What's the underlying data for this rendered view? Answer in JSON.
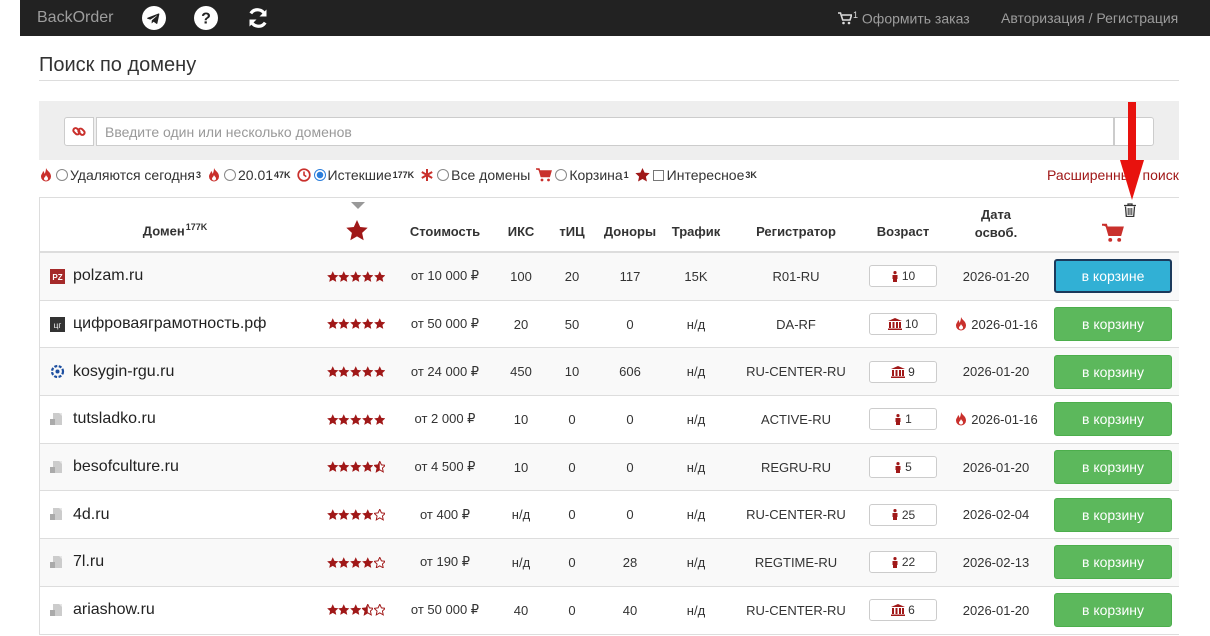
{
  "nav": {
    "brand": "BackOrder",
    "order_label": "Оформить заказ",
    "order_count": "1",
    "auth_label": "Авторизация / Регистрация"
  },
  "page": {
    "title": "Поиск по домену"
  },
  "search": {
    "placeholder": "Введите один или несколько доменов"
  },
  "filters": [
    {
      "label": "Удаляются сегодня",
      "count": "3"
    },
    {
      "label": "20.01",
      "count": "47K"
    },
    {
      "label": "Истекшие",
      "count": "177K",
      "selected": true
    },
    {
      "label": "Все домены",
      "count": ""
    },
    {
      "label": "Корзина",
      "count": "1"
    },
    {
      "label": "Интересное",
      "count": "3K"
    }
  ],
  "advanced_search": "Расширенный поиск",
  "table": {
    "headers": {
      "domain": "Домен",
      "domain_count": "177K",
      "cost": "Стоимость",
      "iks": "ИКС",
      "tic": "тИЦ",
      "donors": "Доноры",
      "traffic": "Трафик",
      "registrar": "Регистратор",
      "age": "Возраст",
      "date_line1": "Дата",
      "date_line2": "освоб."
    },
    "rows": [
      {
        "domain": "polzam.ru",
        "rating": 5,
        "cost": "от 10 000 ₽",
        "iks": "100",
        "tic": "20",
        "donors": "117",
        "traffic": "15K",
        "registrar": "R01-RU",
        "age": "10",
        "date": "2026-01-20",
        "button": "в корзине"
      },
      {
        "domain": "цифроваяграмотность.рф",
        "rating": 5,
        "cost": "от 50 000 ₽",
        "iks": "20",
        "tic": "50",
        "donors": "0",
        "traffic": "н/д",
        "registrar": "DA-RF",
        "age": "10",
        "date": "2026-01-16",
        "button": "в корзину"
      },
      {
        "domain": "kosygin-rgu.ru",
        "rating": 5,
        "cost": "от 24 000 ₽",
        "iks": "450",
        "tic": "10",
        "donors": "606",
        "traffic": "н/д",
        "registrar": "RU-CENTER-RU",
        "age": "9",
        "date": "2026-01-20",
        "button": "в корзину"
      },
      {
        "domain": "tutsladko.ru",
        "rating": 5,
        "cost": "от 2 000 ₽",
        "iks": "10",
        "tic": "0",
        "donors": "0",
        "traffic": "н/д",
        "registrar": "ACTIVE-RU",
        "age": "1",
        "date": "2026-01-16",
        "button": "в корзину"
      },
      {
        "domain": "besofculture.ru",
        "rating": 4.5,
        "cost": "от 4 500 ₽",
        "iks": "10",
        "tic": "0",
        "donors": "0",
        "traffic": "н/д",
        "registrar": "REGRU-RU",
        "age": "5",
        "date": "2026-01-20",
        "button": "в корзину"
      },
      {
        "domain": "4d.ru",
        "rating": 4,
        "cost": "от 400 ₽",
        "iks": "н/д",
        "tic": "0",
        "donors": "0",
        "traffic": "н/д",
        "registrar": "RU-CENTER-RU",
        "age": "25",
        "date": "2026-02-04",
        "button": "в корзину"
      },
      {
        "domain": "7l.ru",
        "rating": 4,
        "cost": "от 190 ₽",
        "iks": "н/д",
        "tic": "0",
        "donors": "28",
        "traffic": "н/д",
        "registrar": "REGTIME-RU",
        "age": "22",
        "date": "2026-02-13",
        "button": "в корзину"
      },
      {
        "domain": "ariashow.ru",
        "rating": 3.5,
        "cost": "от 50 000 ₽",
        "iks": "40",
        "tic": "0",
        "donors": "40",
        "traffic": "н/д",
        "registrar": "RU-CENTER-RU",
        "age": "6",
        "date": "2026-01-20",
        "button": "в корзину"
      }
    ]
  },
  "colors": {
    "accent_red": "#a01818",
    "cart_green": "#5cb85c",
    "in_cart_blue": "#31b0d5",
    "navbar": "#222222"
  }
}
